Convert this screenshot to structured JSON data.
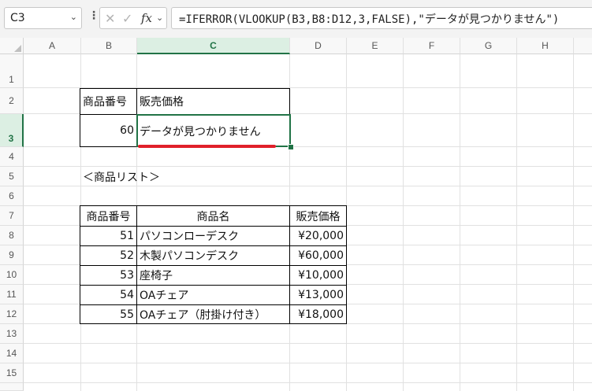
{
  "formula_bar": {
    "name_box": "C3",
    "name_box_arrow": "⌄",
    "more_dots": "⋮",
    "cancel_glyph": "✕",
    "enter_glyph": "✓",
    "fx_label": "fx",
    "fx_arrow": "⌄",
    "formula": "=IFERROR(VLOOKUP(B3,B8:D12,3,FALSE),\"データが見つかりません\")"
  },
  "columns": [
    "A",
    "B",
    "C",
    "D",
    "E",
    "F",
    "G",
    "H"
  ],
  "selected_column": "C",
  "rows": [
    "1",
    "2",
    "3",
    "4",
    "5",
    "6",
    "7",
    "8",
    "9",
    "10",
    "11",
    "12",
    "13",
    "14",
    "15"
  ],
  "selected_row": "3",
  "lookup": {
    "header_number": "商品番号",
    "header_price": "販売価格",
    "input_number": "60",
    "result": "データが見つかりません"
  },
  "list_title": "＜商品リスト＞",
  "product_table": {
    "headers": [
      "商品番号",
      "商品名",
      "販売価格"
    ],
    "rows": [
      {
        "number": "51",
        "name": "パソコンローデスク",
        "price": "¥20,000"
      },
      {
        "number": "52",
        "name": "木製パソコンデスク",
        "price": "¥60,000"
      },
      {
        "number": "53",
        "name": "座椅子",
        "price": "¥10,000"
      },
      {
        "number": "54",
        "name": "OAチェア",
        "price": "¥13,000"
      },
      {
        "number": "55",
        "name": "OAチェア（肘掛け付き）",
        "price": "¥18,000"
      }
    ]
  },
  "colors": {
    "selection": "#217346",
    "annotation_underline": "#e0202a"
  }
}
